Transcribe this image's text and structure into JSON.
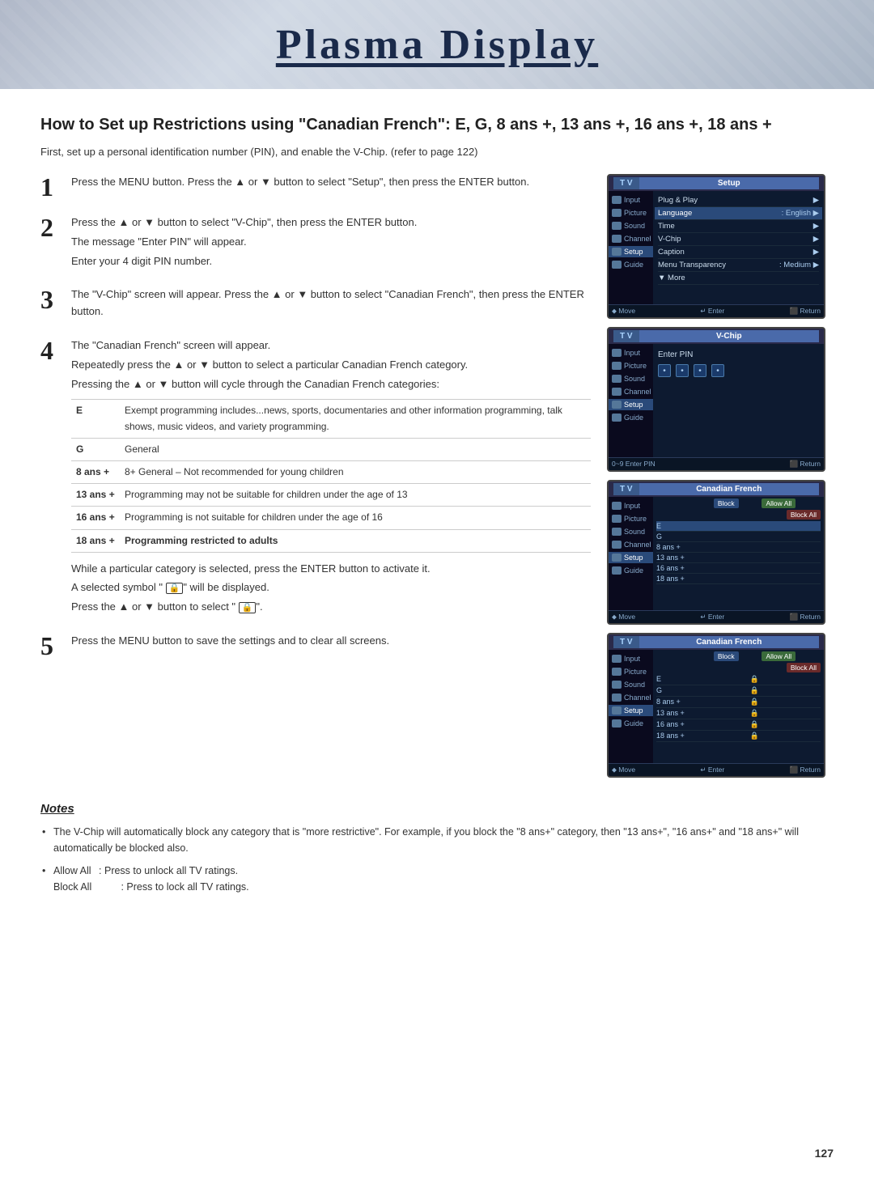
{
  "header": {
    "title": "Plasma Display"
  },
  "page": {
    "heading": "How to Set up Restrictions using \"Canadian French\": E, G, 8 ans +, 13 ans +, 16 ans +, 18 ans +",
    "intro": "First, set up a personal identification number (PIN), and enable the V-Chip. (refer to page 122)",
    "page_number": "127"
  },
  "steps": [
    {
      "number": "1",
      "lines": [
        "Press the MENU button. Press the ▲ or ▼ button to select",
        "\"Setup\", then press the ENTER button."
      ]
    },
    {
      "number": "2",
      "lines": [
        "Press the ▲ or ▼ button to select \"V-Chip\", then press",
        "the ENTER button.",
        "The message \"Enter PIN\" will appear.",
        "Enter your 4 digit PIN number."
      ]
    },
    {
      "number": "3",
      "lines": [
        "The \"V-Chip\" screen will appear. Press the ▲ or ▼ button to",
        "select \"Canadian French\", then press the ENTER button."
      ]
    },
    {
      "number": "4",
      "lines": [
        "The \"Canadian French\" screen will appear.",
        "Repeatedly press the ▲ or ▼ button to select a particular",
        "Canadian French category.",
        "Pressing the ▲ or ▼ button will cycle through the",
        "Canadian French categories:"
      ]
    },
    {
      "number": "5",
      "lines": [
        "Press the MENU button to save the settings and to clear all",
        "screens."
      ]
    }
  ],
  "categories": [
    {
      "label": "E",
      "description": "Exempt programming includes...news, sports, documentaries and other information programming, talk shows, music videos, and variety programming."
    },
    {
      "label": "G",
      "description": "General"
    },
    {
      "label": "8 ans +",
      "description": "8+ General – Not recommended for young children"
    },
    {
      "label": "13 ans +",
      "description": "Programming may not be suitable for children under the age of 13"
    },
    {
      "label": "16 ans +",
      "description": "Programming is not suitable for children under the age of 16"
    },
    {
      "label": "18 ans +",
      "description": "Programming restricted to adults"
    }
  ],
  "step4_notes": [
    "While a particular category is selected, press the ENTER button to activate it.",
    "A selected symbol \" 🔒\" will be displayed.",
    "Press the ▲ or ▼ button to select \" 🔒\"."
  ],
  "tv_screens": [
    {
      "id": "setup",
      "left_label": "T V",
      "right_label": "Setup",
      "sidebar_items": [
        "Input",
        "Picture",
        "Sound",
        "Channel",
        "Setup",
        "Guide"
      ],
      "menu_items": [
        {
          "label": "Plug & Play",
          "value": "",
          "arrow": true
        },
        {
          "label": "Language",
          "value": ": English",
          "arrow": true
        },
        {
          "label": "Time",
          "value": "",
          "arrow": true
        },
        {
          "label": "V-Chip",
          "value": "",
          "arrow": true
        },
        {
          "label": "Caption",
          "value": "",
          "arrow": true
        },
        {
          "label": "Menu Transparency",
          "value": ": Medium",
          "arrow": true
        },
        {
          "label": "▼ More",
          "value": ""
        }
      ],
      "footer": "⬥ Move   ↵ Enter   ⬛ Return"
    },
    {
      "id": "vchip",
      "left_label": "T V",
      "right_label": "V-Chip",
      "sidebar_items": [
        "Input",
        "Picture",
        "Sound",
        "Channel",
        "Setup",
        "Guide"
      ],
      "pin_label": "Enter PIN",
      "footer": "0~9 Enter PIN   ⬛ Return"
    },
    {
      "id": "canadian-french-1",
      "left_label": "T V",
      "right_label": "Canadian French",
      "sidebar_items": [
        "Input",
        "Picture",
        "Sound",
        "Channel",
        "Setup",
        "Guide"
      ],
      "col_block": "Block",
      "col_allow": "Allow All",
      "col_block_all": "Block All",
      "rows": [
        "E",
        "G",
        "8 ans +",
        "13 ans +",
        "16 ans +",
        "18 ans +"
      ],
      "footer": "⬥ Move   ↵ Enter   ⬛ Return"
    },
    {
      "id": "canadian-french-2",
      "left_label": "T V",
      "right_label": "Canadian French",
      "sidebar_items": [
        "Input",
        "Picture",
        "Sound",
        "Channel",
        "Setup",
        "Guide"
      ],
      "col_block": "Block",
      "col_allow": "Allow All",
      "col_block_all": "Block All",
      "rows_with_locks": [
        {
          "label": "E",
          "locked": true
        },
        {
          "label": "G",
          "locked": true
        },
        {
          "label": "8 ans +",
          "locked": true
        },
        {
          "label": "13 ans +",
          "locked": true
        },
        {
          "label": "16 ans +",
          "locked": true
        },
        {
          "label": "18 ans +",
          "locked": true
        }
      ],
      "footer": "⬥ Move   ↵ Enter   ⬛ Return"
    }
  ],
  "notes": {
    "title": "Notes",
    "items": [
      "The V-Chip will automatically block any category that is \"more restrictive\". For example, if you block the \"8 ans+\" category, then \"13 ans+\", \"16 ans+\" and \"18 ans+\" will automatically be blocked also.",
      "Allow All   : Press to unlock all TV ratings.\nBlock All    : Press to lock all TV ratings."
    ]
  }
}
